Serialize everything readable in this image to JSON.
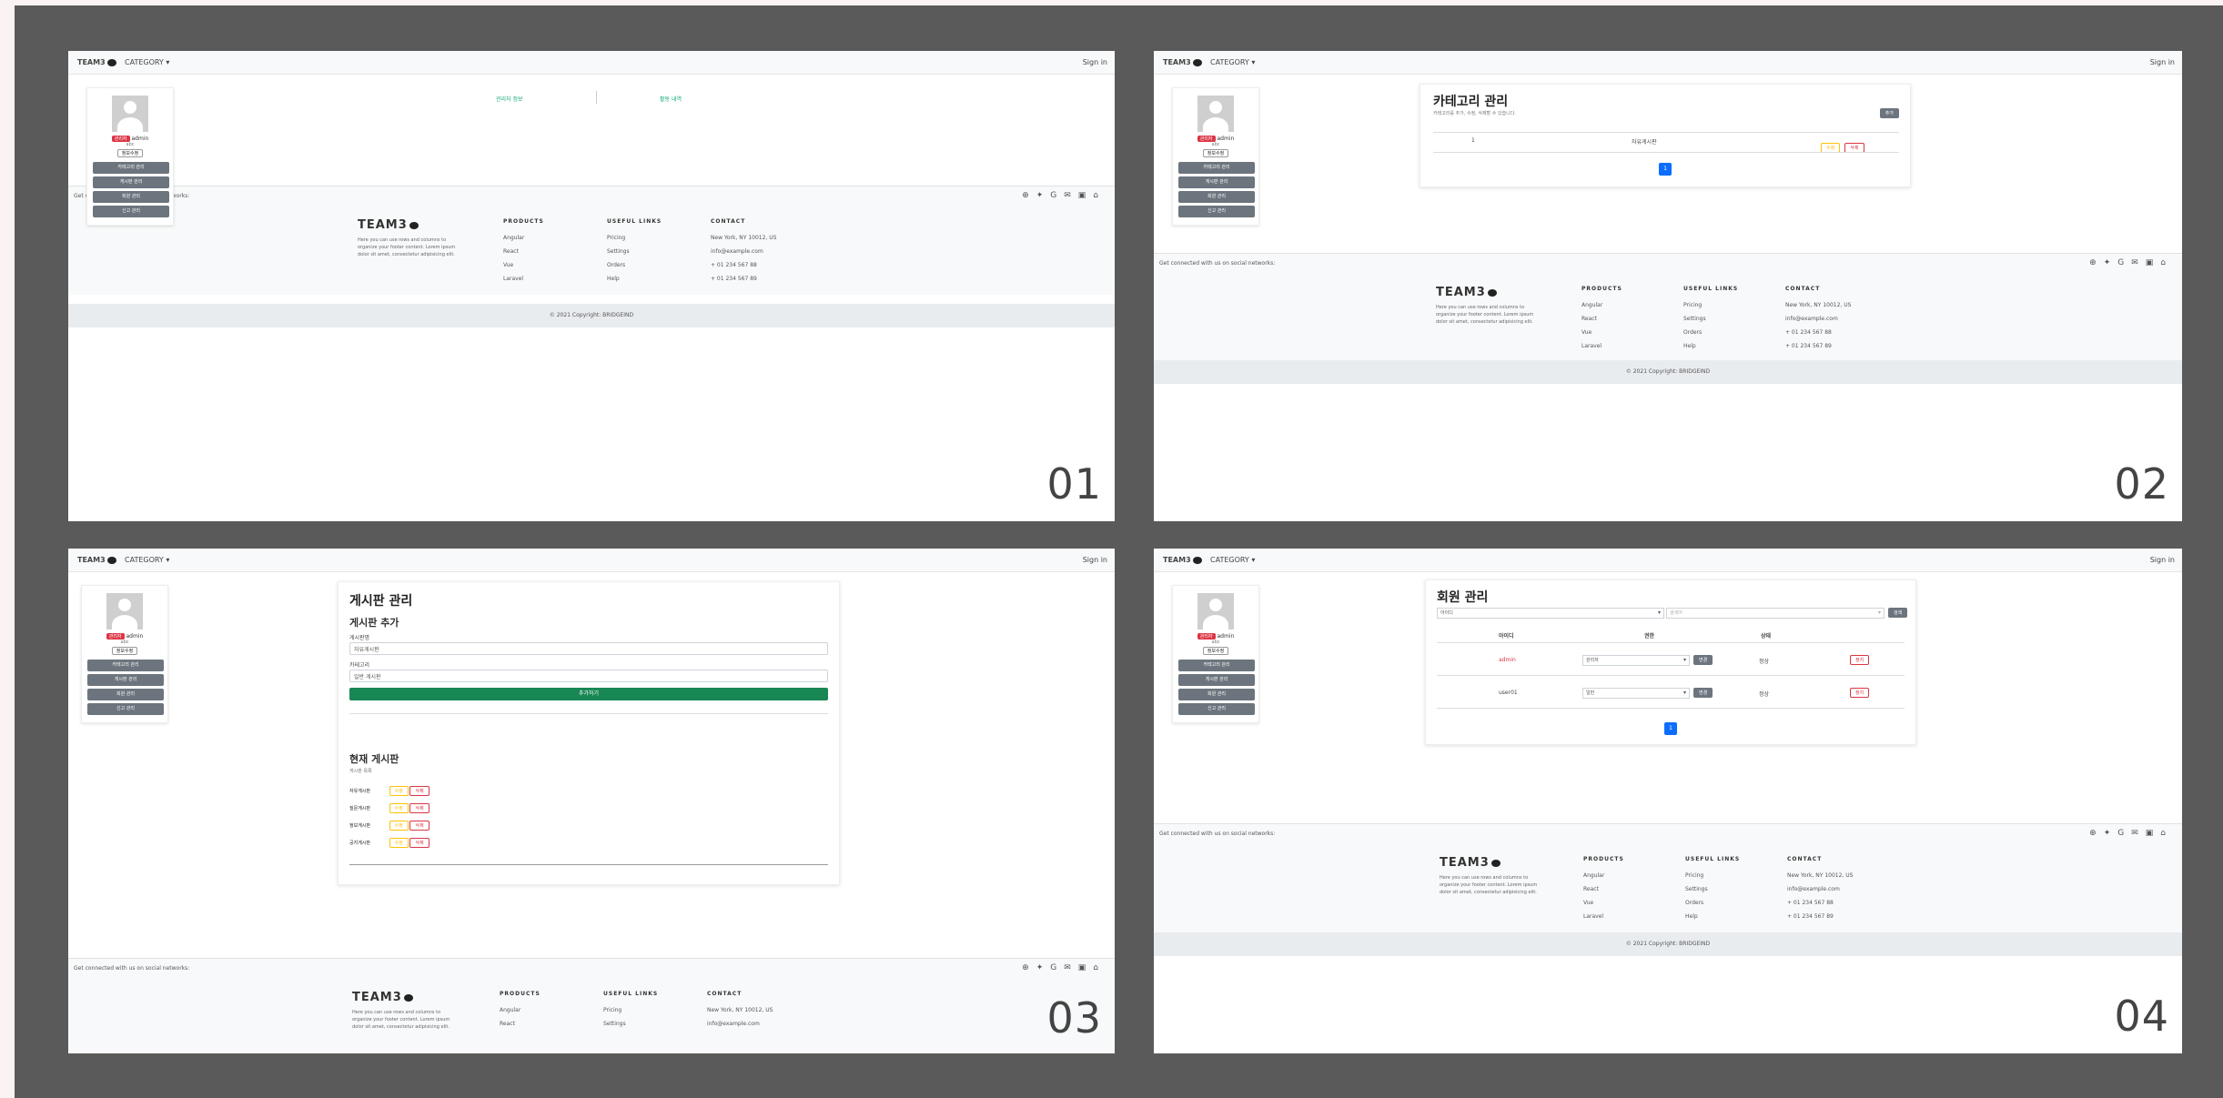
{
  "nav": {
    "brand": "TEAM3",
    "category": "CATEGORY ▾",
    "signin": "Sign in"
  },
  "sidebar": {
    "role": "관리자",
    "username": "admin",
    "small": "abc",
    "pill": "정보수정",
    "items": [
      "카테고리 관리",
      "게시판 관리",
      "회원 관리",
      "신고 관리"
    ]
  },
  "panel1": {
    "tab_left": "관리자 정보",
    "tab_right": "활동 내역",
    "number": "01"
  },
  "panel2": {
    "title": "카테고리 관리",
    "subtitle": "카테고리를 추가, 수정, 삭제할 수 있습니다.",
    "add_button": "추가",
    "col_no": "1",
    "col_name": "자유게시판",
    "edit_label": "수정",
    "delete_label": "삭제",
    "page": "1",
    "number": "02"
  },
  "panel3": {
    "title": "게시판 관리",
    "section_add": "게시판 추가",
    "field_name_label": "게시판명",
    "field_name_value": "자유게시판",
    "field_cat_label": "카테고리",
    "field_cat_value": "일반 게시판",
    "submit": "추가하기",
    "section_list": "현재 게시판",
    "list_sub": "게시판 목록",
    "rows": [
      "자유게시판",
      "질문게시판",
      "정보게시판",
      "공지게시판"
    ],
    "edit_label": "수정",
    "delete_label": "삭제",
    "number": "03"
  },
  "panel4": {
    "title": "회원 관리",
    "search_select": "아이디",
    "search_placeholder": "검색어",
    "search_button": "검색",
    "col_id": "아이디",
    "col_role": "권한",
    "col_state": "상태",
    "rows": [
      {
        "id": "admin",
        "role": "관리자",
        "state": "정상"
      },
      {
        "id": "user01",
        "role": "일반",
        "state": "정상"
      }
    ],
    "change_label": "변경",
    "ban_label": "정지",
    "page": "1",
    "number": "04"
  },
  "footer": {
    "social_text": "Get connected with us on social networks:",
    "brand": "TEAM3",
    "desc": "Here you can use rows and columns to organize your footer content. Lorem ipsum dolor sit amet, consectetur adipisicing elit.",
    "col1_title": "PRODUCTS",
    "col1": [
      "Angular",
      "React",
      "Vue",
      "Laravel"
    ],
    "col2_title": "USEFUL LINKS",
    "col2": [
      "Pricing",
      "Settings",
      "Orders",
      "Help"
    ],
    "col3_title": "CONTACT",
    "col3": [
      "New York, NY 10012, US",
      "info@example.com",
      "+ 01 234 567 88",
      "+ 01 234 567 89"
    ],
    "copyright": "© 2021 Copyright: BRIDGEIND"
  }
}
